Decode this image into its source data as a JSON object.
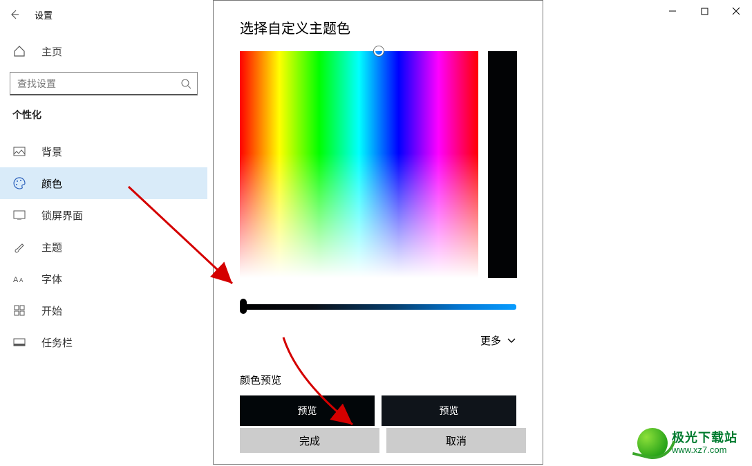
{
  "window": {
    "title": "设置"
  },
  "sidebar": {
    "home": "主页",
    "search_placeholder": "查找设置",
    "category": "个性化",
    "items": [
      {
        "label": "背景"
      },
      {
        "label": "颜色"
      },
      {
        "label": "锁屏界面"
      },
      {
        "label": "主题"
      },
      {
        "label": "字体"
      },
      {
        "label": "开始"
      },
      {
        "label": "任务栏"
      }
    ]
  },
  "picker": {
    "title": "选择自定义主题色",
    "more": "更多",
    "preview_label": "颜色预览",
    "preview1": "预览",
    "preview2": "预览",
    "done": "完成",
    "cancel": "取消",
    "value": 0,
    "selected_hex": "#020609"
  },
  "watermark": {
    "name": "极光下载站",
    "url": "www.xz7.com"
  }
}
